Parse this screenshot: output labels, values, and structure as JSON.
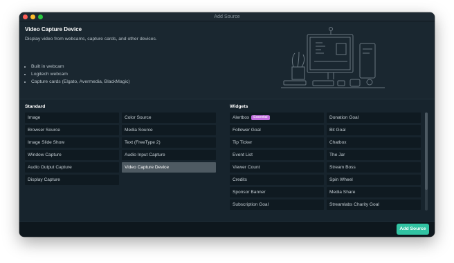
{
  "window": {
    "title": "Add Source"
  },
  "header": {
    "title": "Video Capture Device",
    "description": "Display video from webcams, capture cards, and other devices.",
    "bullets": [
      "Built in webcam",
      "Logitech webcam",
      "Capture cards (Elgato, Avermedia, BlackMagic)"
    ]
  },
  "standard": {
    "label": "Standard",
    "col1": [
      "Image",
      "Browser Source",
      "Image Slide Show",
      "Window Capture",
      "Audio Output Capture",
      "Display Capture"
    ],
    "col2": [
      "Color Source",
      "Media Source",
      "Text (FreeType 2)",
      "Audio Input Capture",
      "Video Capture Device"
    ],
    "selected": "Video Capture Device"
  },
  "widgets": {
    "label": "Widgets",
    "badge": "Essential",
    "col1": [
      "Alertbox",
      "Follower Goal",
      "Tip Ticker",
      "Event List",
      "Viewer Count",
      "Credits",
      "Sponsor Banner",
      "Subscription Goal"
    ],
    "col2": [
      "Donation Goal",
      "Bit Goal",
      "Chatbox",
      "The Jar",
      "Stream Boss",
      "Spin Wheel",
      "Media Share",
      "Streamlabs Charity Goal"
    ]
  },
  "footer": {
    "add_label": "Add Source"
  },
  "colors": {
    "accent": "#31c3a2",
    "badge": "#c26de0",
    "selected": "#4e5a62",
    "background": "#17242d"
  },
  "icons": [
    "close-dot-icon",
    "minimize-dot-icon",
    "zoom-dot-icon",
    "desk-setup-illustration"
  ]
}
